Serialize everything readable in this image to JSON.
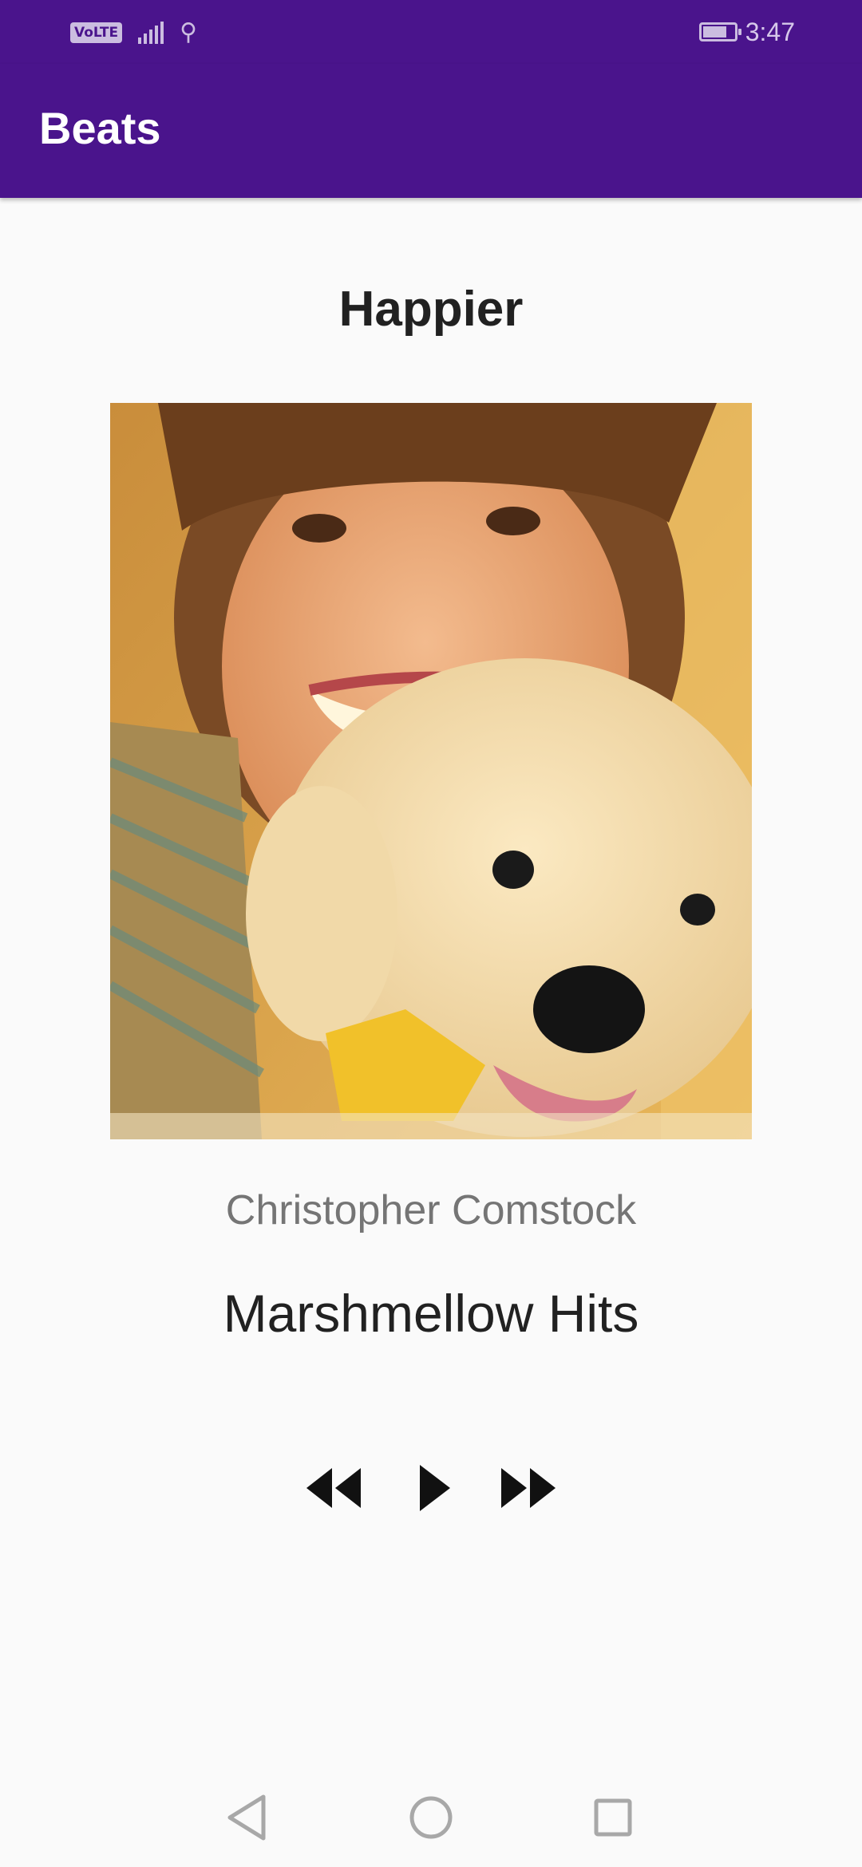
{
  "status_bar": {
    "network_badge": "VoLTE",
    "time": "3:47",
    "icons": [
      "volte-icon",
      "signal-icon",
      "usb-icon",
      "battery-charging-icon"
    ]
  },
  "app_bar": {
    "title": "Beats"
  },
  "player": {
    "song_title": "Happier",
    "artist": "Christopher Comstock",
    "album": "Marshmellow Hits",
    "cover_art": "girl-with-puppy-photo"
  },
  "controls": {
    "icons": [
      "rewind-icon",
      "play-icon",
      "fast-forward-icon"
    ]
  },
  "nav_bar": {
    "icons": [
      "back-icon",
      "home-icon",
      "recents-icon"
    ]
  },
  "colors": {
    "primary": "#4a148c",
    "background": "#fafafa",
    "title_text": "#212121",
    "artist_text": "#757575"
  }
}
